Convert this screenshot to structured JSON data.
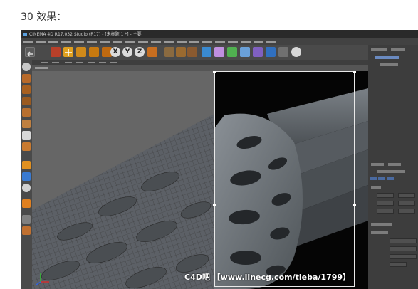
{
  "page": {
    "heading": "30 效果："
  },
  "window": {
    "title": "CINEMA 4D R17.032 Studio (R17) - [未标题 1 *] - 主要"
  },
  "toolbar": {
    "axis_x": "X",
    "axis_y": "Y",
    "axis_z": "Z"
  },
  "watermark": "C4D吧 【www.linecg.com/tieba/1799】",
  "icons": [
    "undo-icon",
    "move-icon",
    "scale-icon",
    "rotate-icon",
    "render-icon",
    "cube-icon",
    "pen-icon",
    "subdivide-icon",
    "array-icon",
    "deformer-icon",
    "camera-icon",
    "light-icon"
  ],
  "colors": {
    "background": "#3b3b3b",
    "viewport": "#7a7a7a",
    "black_region": "#050505",
    "accent": "#f0a030"
  }
}
